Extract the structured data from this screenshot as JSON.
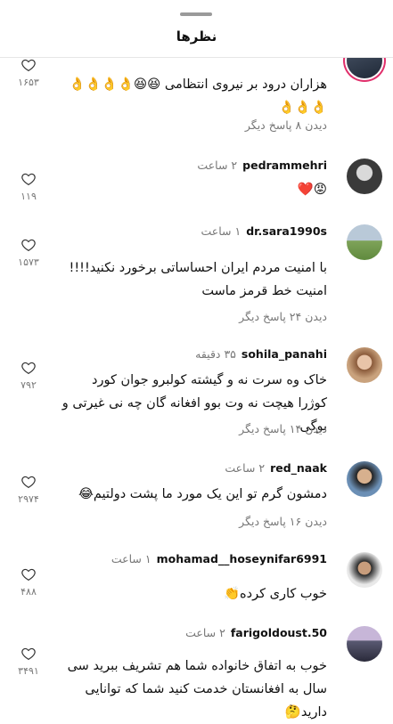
{
  "header": {
    "title": "نظرها"
  },
  "comments": [
    {
      "username": "",
      "time": "",
      "text": "هزاران درود بر نیروی انتظامی 😆😆👌👌👌👌👌👌👌",
      "replies": "دیدن ۸ پاسخ دیگر",
      "likes": "۱۶۵۳"
    },
    {
      "username": "pedrammehri",
      "time": "۲ ساعت",
      "text": "😡❤️",
      "replies": "",
      "likes": "۱۱۹"
    },
    {
      "username": "dr.sara1990s",
      "time": "۱ ساعت",
      "text": "با امنیت مردم ایران احساساتی برخورد نکنید!!!! امنیت خط قرمز ماست",
      "replies": "دیدن ۲۴ پاسخ دیگر",
      "likes": "۱۵۷۳"
    },
    {
      "username": "sohila_panahi",
      "time": "۳۵ دقیقه",
      "text": "خاک وه سرت نه و گیشته کولبرو جوان کورد کوژرا هیچت نه وت بوو افغانه گان چه نی غیرتی و بوگی",
      "replies": "دیدن ۱۴ پاسخ دیگر",
      "likes": "۷۹۲"
    },
    {
      "username": "red_naak",
      "time": "۲ ساعت",
      "text": "دمشون گرم تو این یک مورد ما پشت دولتیم😂",
      "replies": "دیدن ۱۶ پاسخ دیگر",
      "likes": "۲۹۷۴"
    },
    {
      "username": "mohamad__hoseynifar6991",
      "time": "۱ ساعت",
      "text": "خوب کاری کرده👏",
      "replies": "",
      "likes": "۴۸۸"
    },
    {
      "username": "farigoldoust.50",
      "time": "۲ ساعت",
      "text": "خوب به اتفاق خانواده شما هم تشریف ببرید سی سال به افغانستان خدمت کنید شما که توانایی دارید🤔",
      "replies": "",
      "likes": "۳۴۹۱"
    }
  ]
}
